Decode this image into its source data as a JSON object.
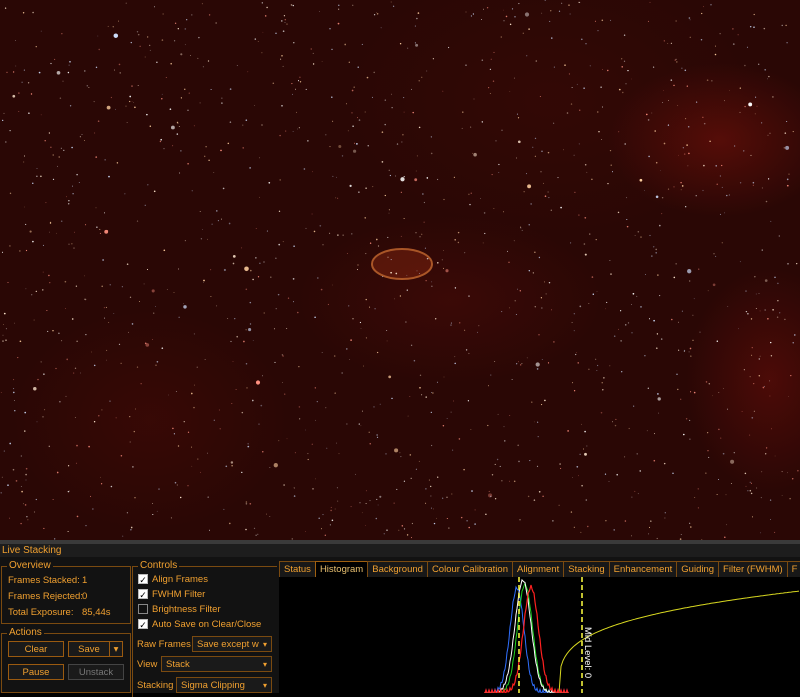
{
  "panel_title": "Live Stacking",
  "overview": {
    "legend": "Overview",
    "frames_stacked_label": "Frames Stacked:",
    "frames_stacked": "1",
    "frames_rejected_label": "Frames Rejected:",
    "frames_rejected": "0",
    "total_exposure_label": "Total Exposure:",
    "total_exposure": "85,44s"
  },
  "actions": {
    "legend": "Actions",
    "clear": "Clear",
    "save": "Save",
    "save_dropdown": "▾",
    "pause": "Pause",
    "unstack": "Unstack"
  },
  "controls": {
    "legend": "Controls",
    "align_frames": "Align Frames",
    "align_frames_checked": true,
    "fwhm_filter": "FWHM Filter",
    "fwhm_filter_checked": true,
    "brightness_filter": "Brightness Filter",
    "brightness_filter_checked": false,
    "auto_save": "Auto Save on Clear/Close",
    "auto_save_checked": true,
    "raw_frames_label": "Raw Frames",
    "raw_frames_value": "Save except w",
    "view_label": "View",
    "view_value": "Stack",
    "stacking_label": "Stacking",
    "stacking_value": "Sigma Clipping"
  },
  "tabs": [
    "Status",
    "Histogram",
    "Background",
    "Colour Calibration",
    "Alignment",
    "Stacking",
    "Enhancement",
    "Guiding",
    "Filter (FWHM)",
    "F"
  ],
  "active_tab": "Histogram",
  "histogram": {
    "mid_level_label": "Mid Level: 0",
    "colors": {
      "red": "#ff2020",
      "green": "#20d020",
      "blue": "#3070ff",
      "white": "#ffffff",
      "curve": "#d8d820",
      "marker": "#ffff40"
    }
  },
  "theme": {
    "accent": "#f0a030",
    "border": "#7a4a10"
  }
}
